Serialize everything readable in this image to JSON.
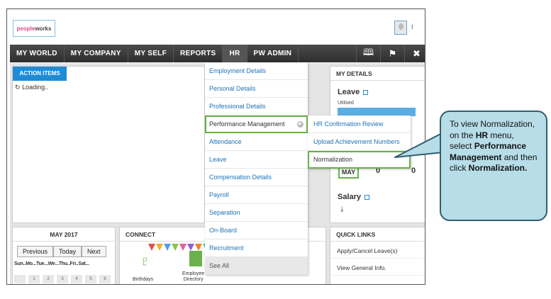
{
  "app": {
    "logo_text_a": "people",
    "logo_text_b": "works",
    "user_initial": "I"
  },
  "nav": {
    "items": [
      "MY WORLD",
      "MY COMPANY",
      "MY SELF",
      "REPORTS",
      "HR",
      "PW ADMIN"
    ],
    "icons": [
      "book-icon",
      "flag-icon",
      "tools-icon"
    ]
  },
  "action_items": {
    "tab_label": "ACTION ITEMS",
    "loading_text": "Loading.."
  },
  "my_details": {
    "title": "MY DETAILS",
    "leave_title": "Leave",
    "utilised_label": "Utilised",
    "month_label": "MAY",
    "value_a": "0",
    "value_b": "0",
    "salary_title": "Salary"
  },
  "calendar": {
    "title": "MAY 2017",
    "prev_label": "Previous",
    "today_label": "Today",
    "next_label": "Next",
    "day_headers": "Sun..Mo...Tue...We...Thu..Fri..Sat...",
    "cells": [
      "",
      "1",
      "2",
      "3",
      "4",
      "5",
      "6"
    ]
  },
  "connect": {
    "title": "CONNECT",
    "birthdays_label": "Birthdays",
    "directory_label_a": "Employee",
    "directory_label_b": "Directory"
  },
  "quick_links": {
    "title": "QUICK LINKS",
    "items": [
      "Apply/Cancel Leave(s)",
      "View General Info."
    ]
  },
  "hr_menu": {
    "items": [
      "Employment Details",
      "Personal Details",
      "Professional Details",
      "Performance Management",
      "Attendance",
      "Leave",
      "Compensation Details",
      "Payroll",
      "Separation",
      "On-Board",
      "Recruitment",
      "See All"
    ]
  },
  "submenu": {
    "items": [
      "HR Confirmation Review",
      "Upload Achievement Numbers",
      "Normalization"
    ]
  },
  "callout": {
    "line1": "To view Normalization, on the ",
    "hr": "HR",
    "line2": " menu, select ",
    "pm": "Performance Management",
    "line3": " and then click ",
    "norm": "Normalization."
  },
  "colors": {
    "accent_blue": "#1f8bd6",
    "highlight_green": "#6ab04c",
    "nav_dark": "#2e2e2e",
    "callout_fill": "#b7dde8",
    "callout_border": "#2f5f6e"
  }
}
